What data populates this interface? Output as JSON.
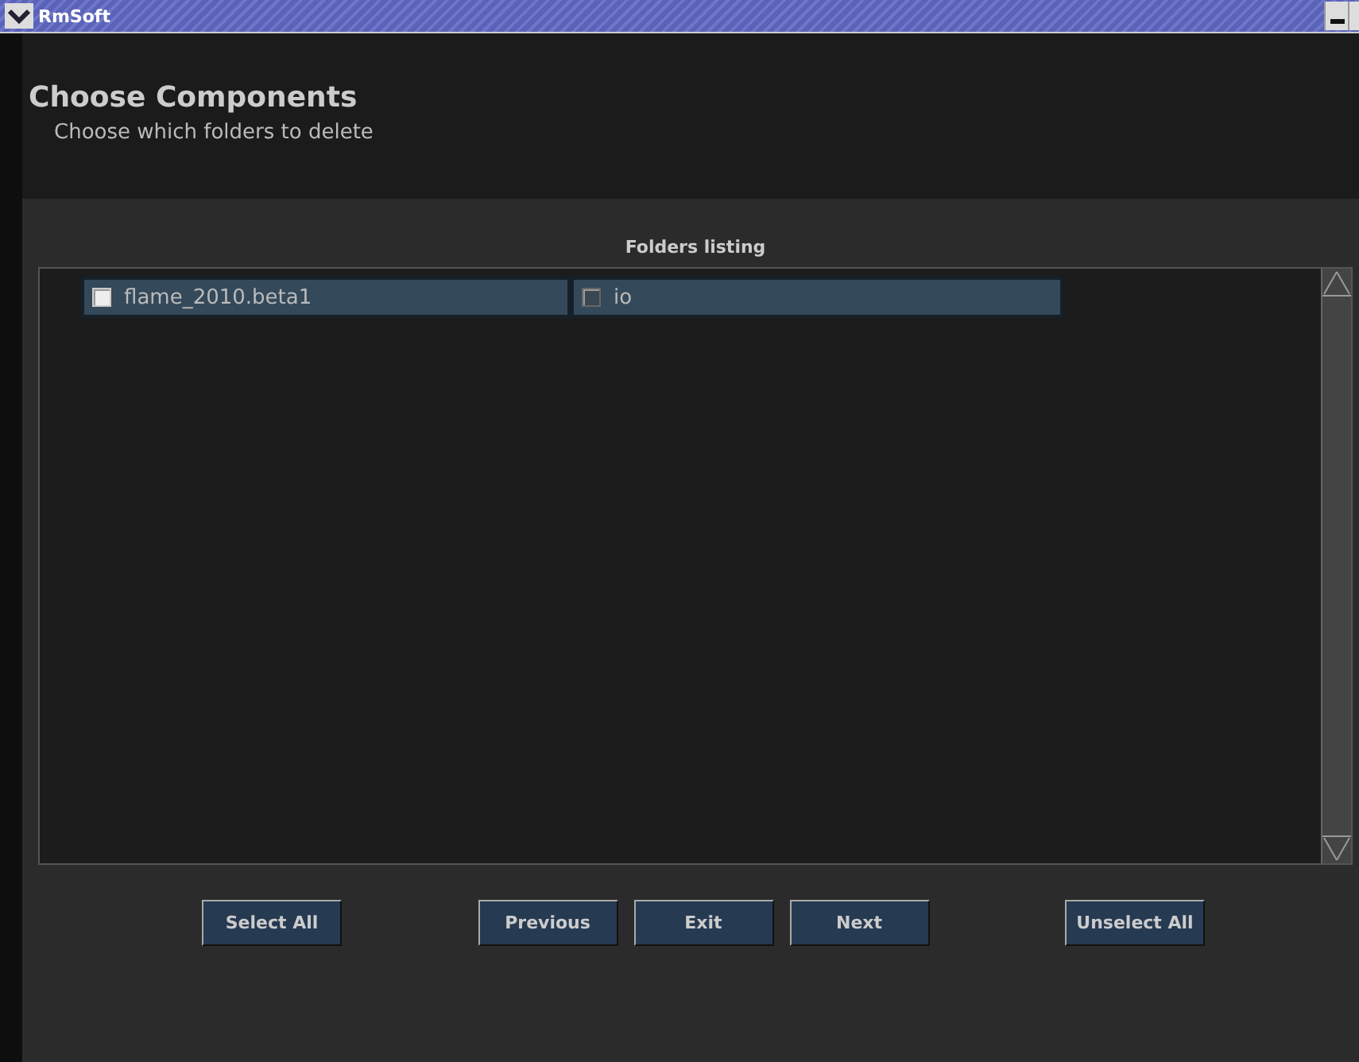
{
  "window": {
    "title": "RmSoft"
  },
  "header": {
    "title": "Choose Components",
    "subtitle": "Choose which folders to delete"
  },
  "listing": {
    "title": "Folders listing",
    "folders": [
      {
        "label": "flame_2010.beta1",
        "checked": true
      },
      {
        "label": "io",
        "checked": false
      }
    ]
  },
  "buttons": [
    "Select All",
    "Previous",
    "Exit",
    "Next",
    "Unselect All"
  ]
}
